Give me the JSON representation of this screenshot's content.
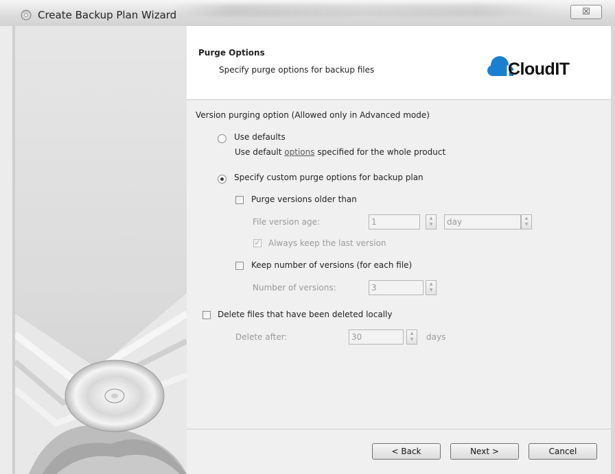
{
  "window": {
    "title": "Create Backup Plan Wizard",
    "close_glyph": "☒"
  },
  "header": {
    "title": "Purge Options",
    "subtitle": "Specify purge options for backup files",
    "logo_text": "CloudIT",
    "logo_mark": "F"
  },
  "section": {
    "heading": "Version purging option (Allowed only in Advanced mode)",
    "use_defaults_label": "Use defaults",
    "use_defaults_desc_prefix": "Use default",
    "use_defaults_desc_link": "options",
    "use_defaults_desc_suffix": "specified for the whole product",
    "custom_label": "Specify custom purge options for backup plan",
    "purge_older_label": "Purge versions older than",
    "file_version_age_label": "File version age:",
    "file_version_age_value": "1",
    "file_version_age_unit": "day",
    "always_keep_label": "Always keep the last version",
    "keep_number_label": "Keep number of versions (for each file)",
    "number_of_versions_label": "Number of versions:",
    "number_of_versions_value": "3",
    "delete_local_label": "Delete files that have been deleted locally",
    "delete_after_label": "Delete after:",
    "delete_after_value": "30",
    "delete_after_unit": "days"
  },
  "state": {
    "selected_radio": "custom",
    "purge_older_checked": false,
    "always_keep_checked": true,
    "keep_number_checked": false,
    "delete_local_checked": false
  },
  "footer": {
    "back_label": "< Back",
    "next_label": "Next >",
    "cancel_label": "Cancel"
  },
  "colors": {
    "logo_blue": "#1b7fd0"
  }
}
